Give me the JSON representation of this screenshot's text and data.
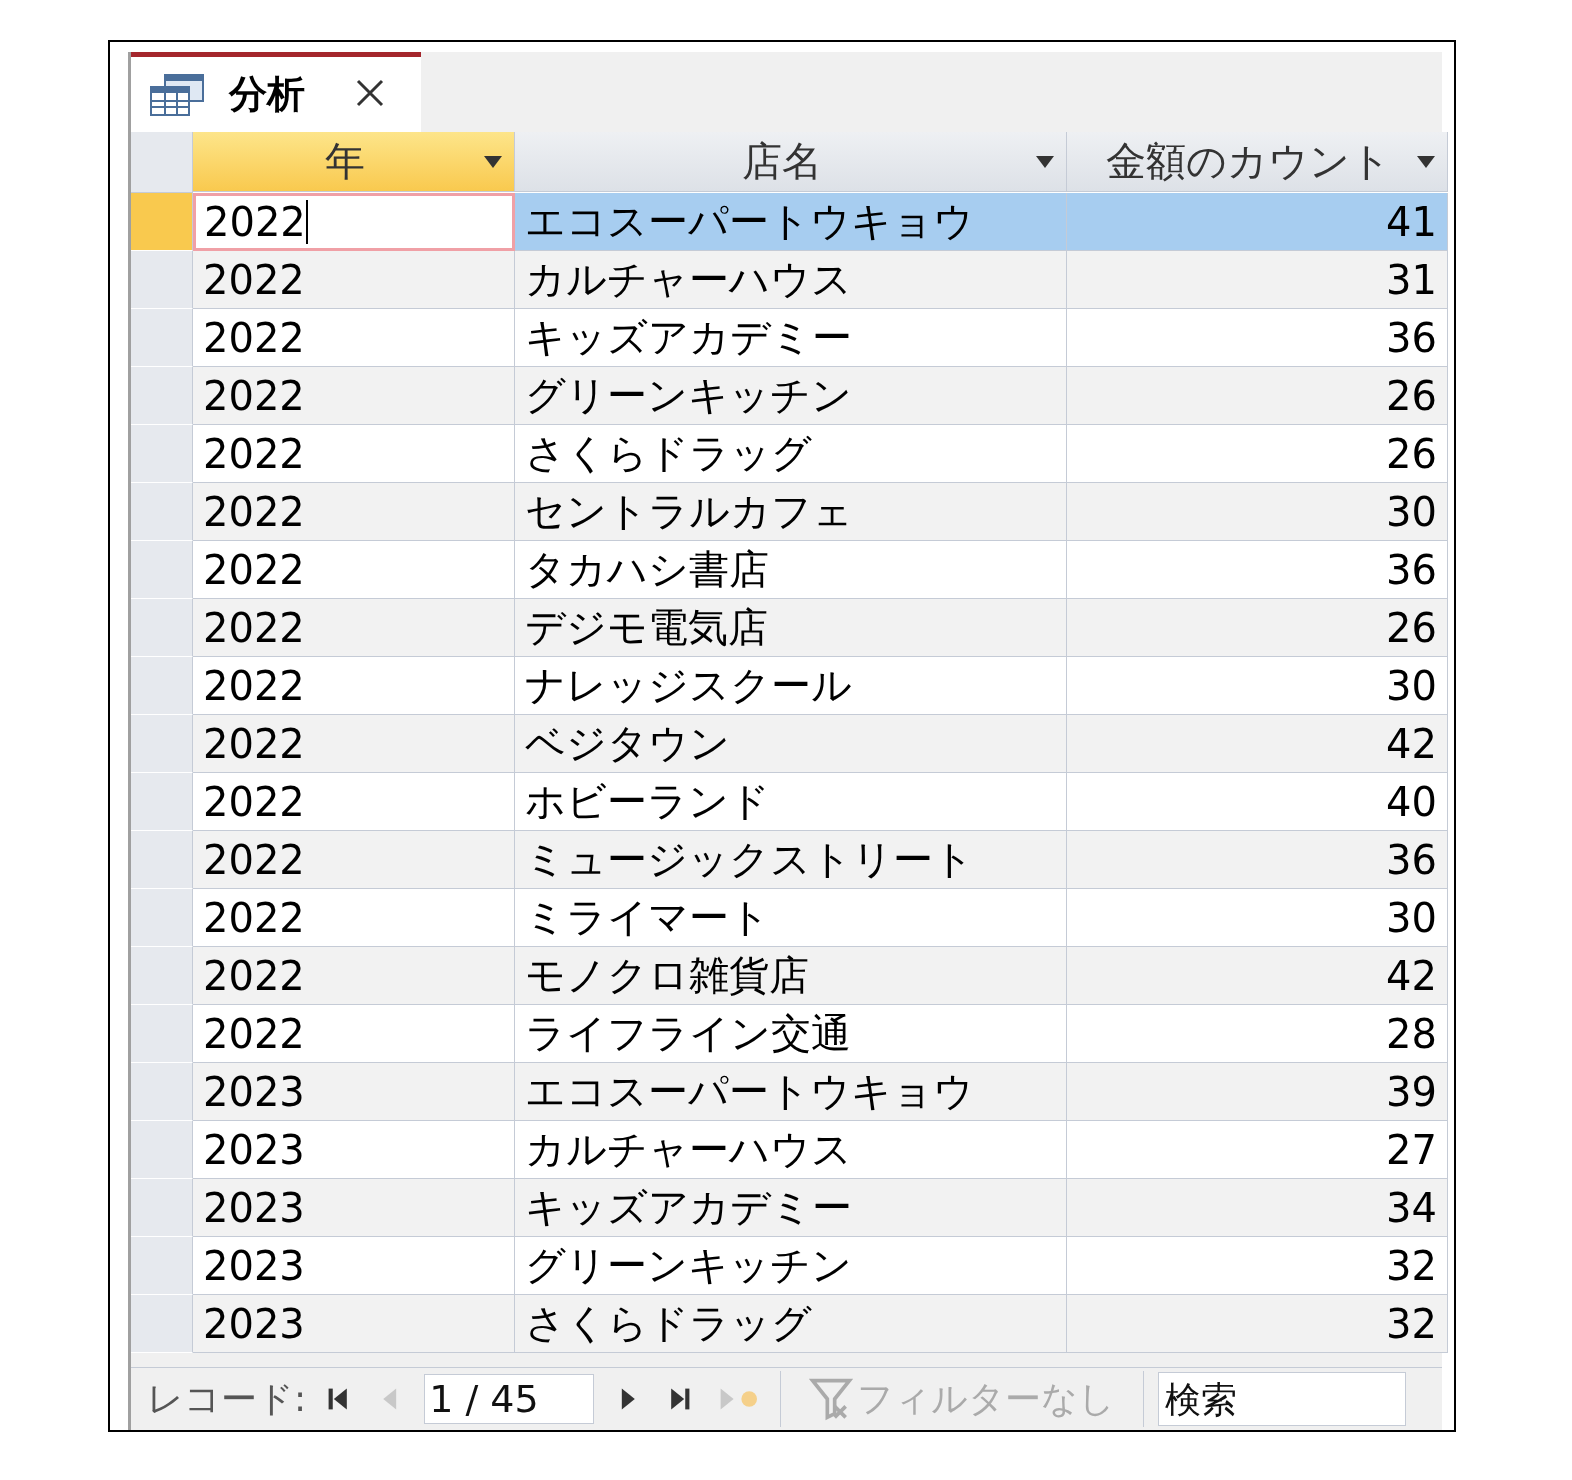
{
  "tab": {
    "title": "分析",
    "selected": true
  },
  "columns": [
    {
      "label": "年",
      "selected": true
    },
    {
      "label": "店名",
      "selected": false
    },
    {
      "label": "金額のカウント",
      "selected": false
    }
  ],
  "rows": [
    {
      "year": "2022",
      "store": "エコスーパートウキョウ",
      "count": "41",
      "selected": true
    },
    {
      "year": "2022",
      "store": "カルチャーハウス",
      "count": "31",
      "selected": false
    },
    {
      "year": "2022",
      "store": "キッズアカデミー",
      "count": "36",
      "selected": false
    },
    {
      "year": "2022",
      "store": "グリーンキッチン",
      "count": "26",
      "selected": false
    },
    {
      "year": "2022",
      "store": "さくらドラッグ",
      "count": "26",
      "selected": false
    },
    {
      "year": "2022",
      "store": "セントラルカフェ",
      "count": "30",
      "selected": false
    },
    {
      "year": "2022",
      "store": "タカハシ書店",
      "count": "36",
      "selected": false
    },
    {
      "year": "2022",
      "store": "デジモ電気店",
      "count": "26",
      "selected": false
    },
    {
      "year": "2022",
      "store": "ナレッジスクール",
      "count": "30",
      "selected": false
    },
    {
      "year": "2022",
      "store": "ベジタウン",
      "count": "42",
      "selected": false
    },
    {
      "year": "2022",
      "store": "ホビーランド",
      "count": "40",
      "selected": false
    },
    {
      "year": "2022",
      "store": "ミュージックストリート",
      "count": "36",
      "selected": false
    },
    {
      "year": "2022",
      "store": "ミライマート",
      "count": "30",
      "selected": false
    },
    {
      "year": "2022",
      "store": "モノクロ雑貨店",
      "count": "42",
      "selected": false
    },
    {
      "year": "2022",
      "store": "ライフライン交通",
      "count": "28",
      "selected": false
    },
    {
      "year": "2023",
      "store": "エコスーパートウキョウ",
      "count": "39",
      "selected": false
    },
    {
      "year": "2023",
      "store": "カルチャーハウス",
      "count": "27",
      "selected": false
    },
    {
      "year": "2023",
      "store": "キッズアカデミー",
      "count": "34",
      "selected": false
    },
    {
      "year": "2023",
      "store": "グリーンキッチン",
      "count": "32",
      "selected": false
    },
    {
      "year": "2023",
      "store": "さくらドラッグ",
      "count": "32",
      "selected": false
    }
  ],
  "navigator": {
    "label": "レコード:",
    "position": "1 / 45",
    "filter": "フィルターなし",
    "search_placeholder": "検索",
    "buttons": [
      {
        "kind": "first",
        "disabled": false
      },
      {
        "kind": "prev",
        "disabled": true
      },
      {
        "kind": "next",
        "disabled": false
      },
      {
        "kind": "last",
        "disabled": false
      },
      {
        "kind": "new",
        "disabled": true
      }
    ]
  }
}
